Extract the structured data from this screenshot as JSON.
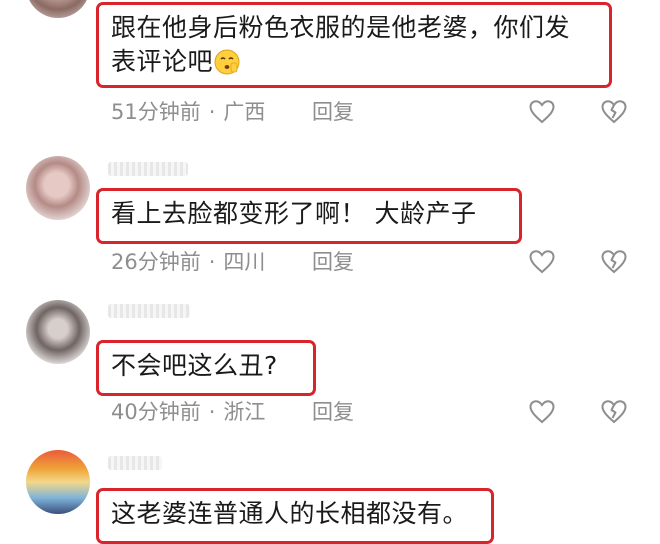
{
  "comments": [
    {
      "text_line1": "跟在他身后粉色衣服的是他老婆，你们发",
      "text_line2": "表评论吧",
      "emoji": "shushing-face-emoji",
      "time": "51分钟前",
      "separator": "·",
      "location": "广西",
      "reply_label": "回复"
    },
    {
      "text": "看上去脸都变形了啊！ 大龄产子",
      "time": "26分钟前",
      "separator": "·",
      "location": "四川",
      "reply_label": "回复"
    },
    {
      "text": "不会吧这么丑?",
      "time": "40分钟前",
      "separator": "·",
      "location": "浙江",
      "reply_label": "回复"
    },
    {
      "text": "这老婆连普通人的长相都没有。"
    }
  ],
  "icons": {
    "like": "heart-outline-icon",
    "dislike": "broken-heart-icon"
  },
  "colors": {
    "highlight_border": "#d9242b",
    "meta_text": "#8e8e8e",
    "body_text": "#1a1a1a"
  }
}
